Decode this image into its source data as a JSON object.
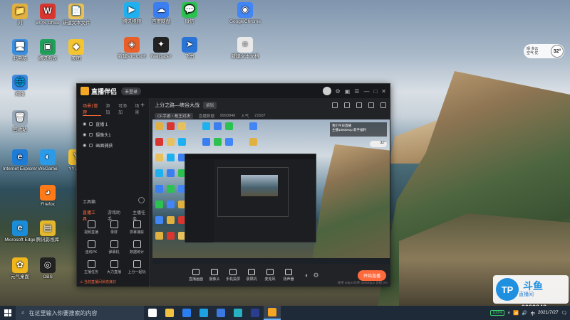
{
  "desktop": {
    "icons": [
      {
        "label": "刘",
        "color": "#e0b040",
        "glyph": "📁"
      },
      {
        "label": "WPS Office",
        "color": "#d8362f",
        "glyph": "W"
      },
      {
        "label": "新建文本文件",
        "color": "#e8c15c",
        "glyph": "📄"
      },
      {
        "label": "腾讯视频",
        "color": "#1fb0f0",
        "glyph": "▶"
      },
      {
        "label": "百度网盘",
        "color": "#3a7ef0",
        "glyph": "☁"
      },
      {
        "label": "微信",
        "color": "#2cc251",
        "glyph": "💬"
      },
      {
        "label": "GoogleChrome",
        "color": "#4285f4",
        "glyph": "◉"
      },
      {
        "label": "此电脑",
        "color": "#3a8ee0",
        "glyph": "🖥"
      },
      {
        "label": "腾讯会议",
        "color": "#1f9f5a",
        "glyph": "▣"
      },
      {
        "label": "美团",
        "color": "#f5c431",
        "glyph": "◆"
      },
      {
        "label": "新建Microsoft",
        "color": "#e85f2a",
        "glyph": "◈"
      },
      {
        "label": "Wallpaper",
        "color": "#222222",
        "glyph": "✦"
      },
      {
        "label": "飞书",
        "color": "#2a74d6",
        "glyph": "➤"
      },
      {
        "label": "新建文本文档",
        "color": "#e9e9e9",
        "glyph": "≡"
      },
      {
        "label": "网络",
        "color": "#3c8be0",
        "glyph": "🌐"
      },
      {
        "label": "回收站",
        "color": "#9aa9b8",
        "glyph": "🗑"
      },
      {
        "label": "Internet Explorer",
        "color": "#1e7bd6",
        "glyph": "e"
      },
      {
        "label": "WeGame",
        "color": "#2b9be8",
        "glyph": "◐"
      },
      {
        "label": "YY语音",
        "color": "#f5c431",
        "glyph": "Y"
      },
      {
        "label": "Firefox",
        "color": "#ff7a18",
        "glyph": "◕"
      },
      {
        "label": "Microsoft Edge",
        "color": "#1a8cd8",
        "glyph": "e"
      },
      {
        "label": "腾讯影视库",
        "color": "#e4b72f",
        "glyph": "▤"
      },
      {
        "label": "元气桌面",
        "color": "#f0b71d",
        "glyph": "✿"
      },
      {
        "label": "OBS",
        "color": "#222222",
        "glyph": "◎"
      }
    ]
  },
  "weather": {
    "line1": "晴 多云",
    "line2": "空气 优",
    "temp": "32°"
  },
  "app": {
    "title": "直播伴侣",
    "badge": "未登录",
    "left_tabs": [
      "场景1管理",
      "添加",
      "可添加",
      "场景"
    ],
    "scenes": [
      {
        "name": "直播 1"
      },
      {
        "name": "摄像头1"
      },
      {
        "name": "画面捕获"
      }
    ],
    "toolbox_title": "工具箱",
    "tool_tabs": [
      "直播工具",
      "游戏助手",
      "主播任务"
    ],
    "tools": [
      "视频直播",
      "录屏",
      "屏幕捕获",
      "连线PK",
      "弹幕机",
      "数据统计",
      "主播任务",
      "大力直播",
      "上分一起玩"
    ],
    "footer_notice": "⚠ 当前直播间状态良好",
    "main_title": "上分之路—峡谷大战",
    "main_tag": "编辑",
    "sub_header": {
      "category": "CF手游・枪王对决",
      "label1": "直播数据",
      "value1": "9993848",
      "label2": "人气",
      "value2": "21507"
    },
    "preview_banner_line1": "我们今日直播",
    "preview_banner_line2": "主播10000exp 新手福利",
    "preview_weather": "32°",
    "bottom_items": [
      "直播画面",
      "摄像头",
      "手机投屏",
      "录屏机",
      "麦克风",
      "扬声器"
    ],
    "start_button": "开始直播",
    "status_right": "帧率 60fps 码率 2500kbps 丢帧 0%"
  },
  "watermark": {
    "brand": "斗鱼",
    "sub": "直播间",
    "room_id": "9993848"
  },
  "taskbar": {
    "search_placeholder": "在这里输入你要搜索的内容",
    "apps": [
      {
        "name": "task-view",
        "color": "#ffffff"
      },
      {
        "name": "file-explorer",
        "color": "#f0c040"
      },
      {
        "name": "mail",
        "color": "#2a7ef0"
      },
      {
        "name": "edge",
        "color": "#1ea1e0"
      },
      {
        "name": "lark",
        "color": "#3b79e0"
      },
      {
        "name": "browser",
        "color": "#27b0c0"
      },
      {
        "name": "photoshop",
        "color": "#2a3d8f"
      },
      {
        "name": "live-companion",
        "color": "#f5a623"
      }
    ],
    "battery": "100%",
    "lang": "中",
    "time": "",
    "date": "2021/7/27"
  }
}
